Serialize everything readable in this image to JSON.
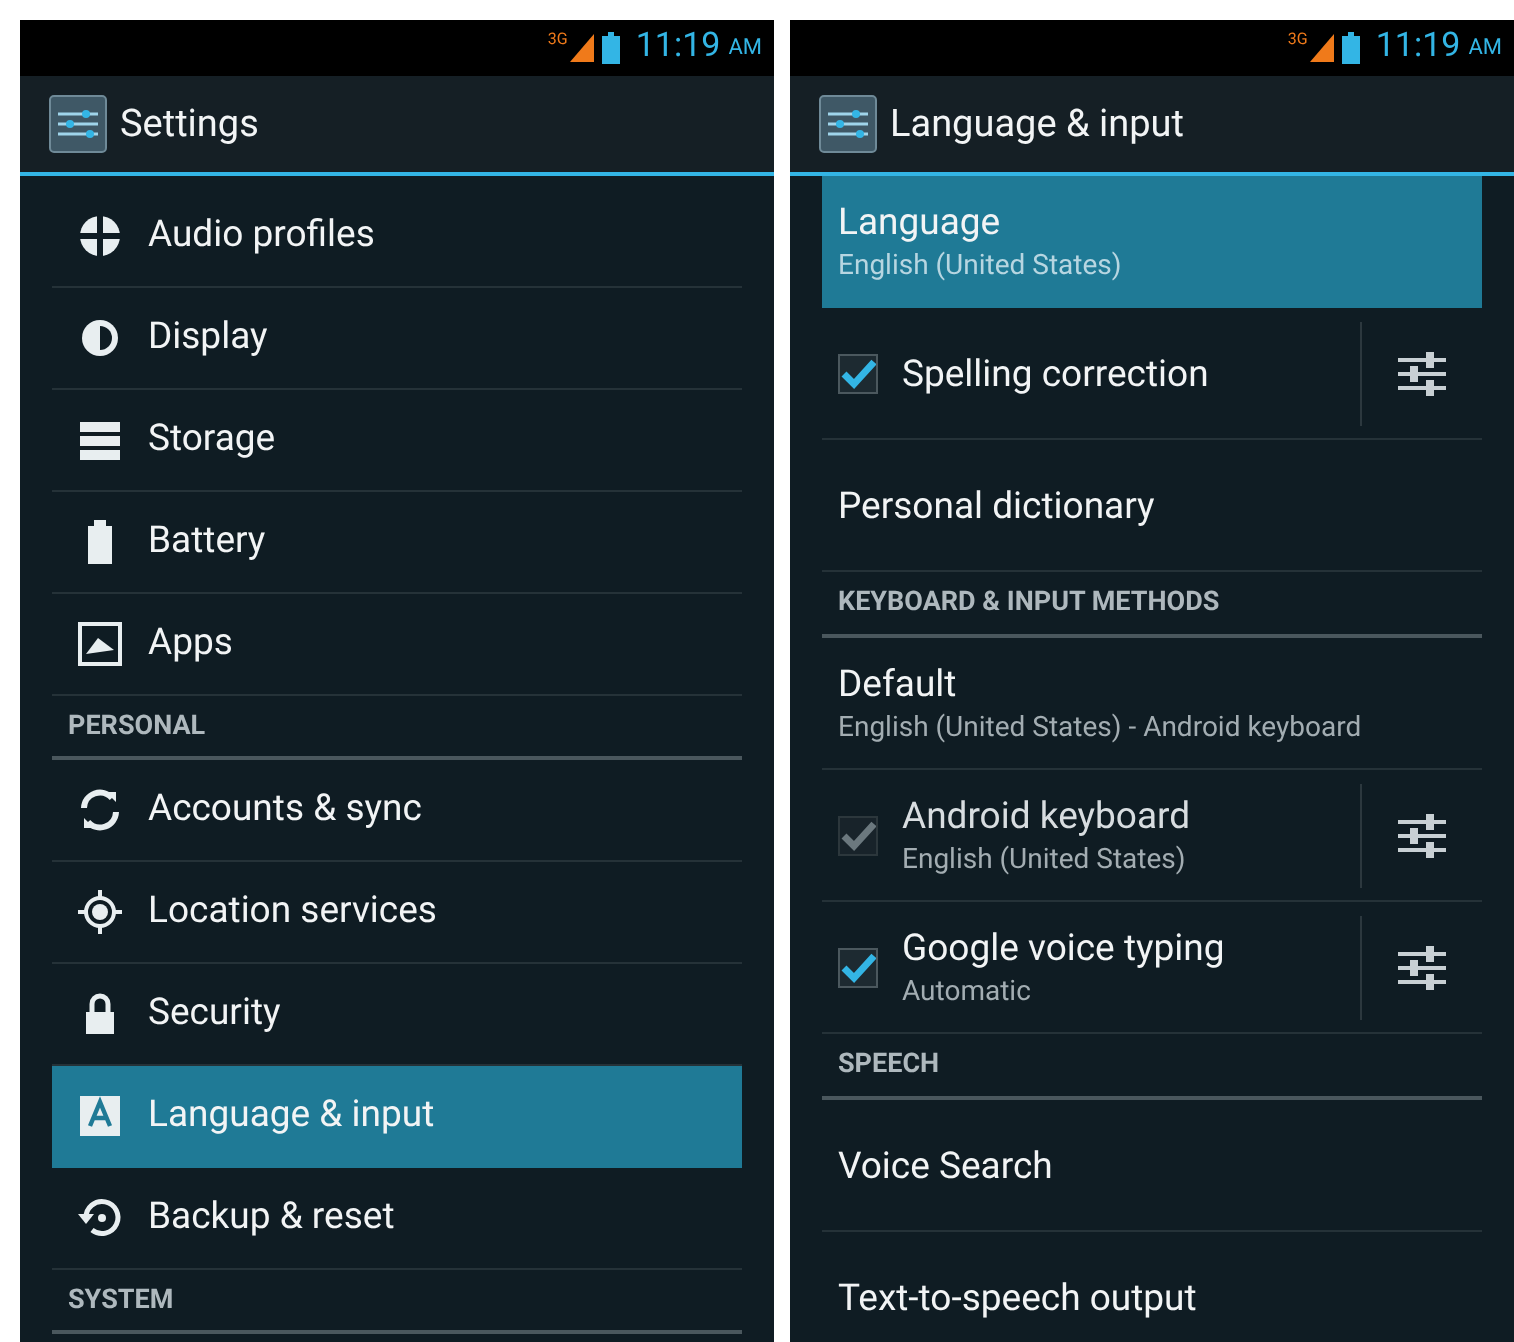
{
  "screens": [
    {
      "status_bar": {
        "network": "3G",
        "time": "11:19",
        "ampm": "AM"
      },
      "action_bar": {
        "title": "Settings"
      },
      "list": [
        {
          "kind": "item",
          "label": "Audio profiles",
          "selected": false
        },
        {
          "kind": "item",
          "label": "Display",
          "selected": false
        },
        {
          "kind": "item",
          "label": "Storage",
          "selected": false
        },
        {
          "kind": "item",
          "label": "Battery",
          "selected": false
        },
        {
          "kind": "item",
          "label": "Apps",
          "selected": false
        },
        {
          "kind": "header",
          "label": "PERSONAL"
        },
        {
          "kind": "item",
          "label": "Accounts & sync",
          "selected": false
        },
        {
          "kind": "item",
          "label": "Location services",
          "selected": false
        },
        {
          "kind": "item",
          "label": "Security",
          "selected": false
        },
        {
          "kind": "item",
          "label": "Language & input",
          "selected": true
        },
        {
          "kind": "item",
          "label": "Backup & reset",
          "selected": false
        },
        {
          "kind": "header",
          "label": "SYSTEM"
        }
      ]
    },
    {
      "status_bar": {
        "network": "3G",
        "time": "11:19",
        "ampm": "AM"
      },
      "action_bar": {
        "title": "Language & input"
      },
      "list": [
        {
          "kind": "pref",
          "title": "Language",
          "subtitle": "English (United States)",
          "selected": true
        },
        {
          "kind": "check",
          "title": "Spelling correction",
          "checked": true,
          "disabled": false
        },
        {
          "kind": "pref",
          "title": "Personal dictionary",
          "selected": false
        },
        {
          "kind": "header",
          "label": "KEYBOARD & INPUT METHODS"
        },
        {
          "kind": "pref",
          "title": "Default",
          "subtitle": "English (United States) - Android keyboard",
          "selected": false
        },
        {
          "kind": "check",
          "title": "Android keyboard",
          "subtitle": "English (United States)",
          "checked": true,
          "disabled": true
        },
        {
          "kind": "check",
          "title": "Google voice typing",
          "subtitle": "Automatic",
          "checked": true,
          "disabled": false
        },
        {
          "kind": "header",
          "label": "SPEECH"
        },
        {
          "kind": "pref",
          "title": "Voice Search",
          "selected": false
        },
        {
          "kind": "pref",
          "title": "Text-to-speech output",
          "selected": false
        }
      ]
    }
  ]
}
